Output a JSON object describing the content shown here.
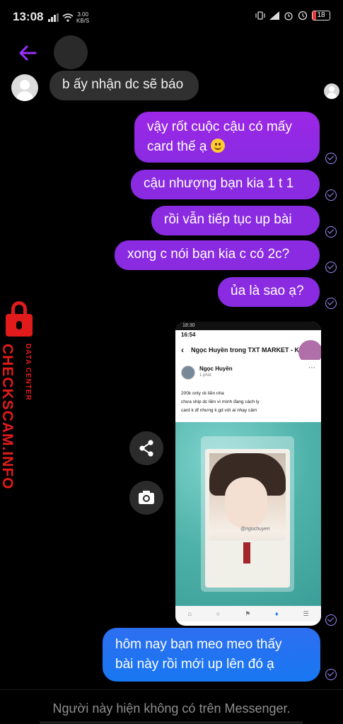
{
  "status_bar": {
    "time": "13:08",
    "net_speed_value": "3.00",
    "net_speed_unit": "KB/S",
    "battery": "18"
  },
  "header": {
    "back_icon": "arrow-left-icon",
    "accent": "#8a2be2"
  },
  "messages": {
    "incoming_1": "b ấy nhận dc sẽ báo",
    "out_1_line1": "vậy rốt cuộc cậu có mấy",
    "out_1_line2": "card thế ạ",
    "out_2": "cậu nhượng bạn kia 1 t 1",
    "out_3": "rồi vẫn tiếp tục up bài",
    "out_4": "xong c nói bạn kia c có 2c?",
    "out_5": "ủa là sao ạ?",
    "out_6_line1": "hôm nay bạn meo meo thấy",
    "out_6_line2": "bài này rồi mới up lên đó ạ"
  },
  "shared_screenshot": {
    "status_time_small": "18:30",
    "status_time": "16:54",
    "group_title": "Ngọc Huyền trong TXT MARKET - K",
    "post_author": "Ngọc Huyền",
    "post_time": "1 phút",
    "post_line1": "200k only ck liền nha",
    "post_line2": "chưa ship dc liền vì mình đang cách ly",
    "post_line3": "card k df nhưng k gd với ai nhạy cảm",
    "photo_watermark": "@ngochuyen"
  },
  "watermark": {
    "brand": "CHECKSCAM.INFO",
    "sub": "DATA CENTER",
    "color": "#e11b1b"
  },
  "footer": {
    "notice": "Người này hiện không có trên Messenger."
  }
}
